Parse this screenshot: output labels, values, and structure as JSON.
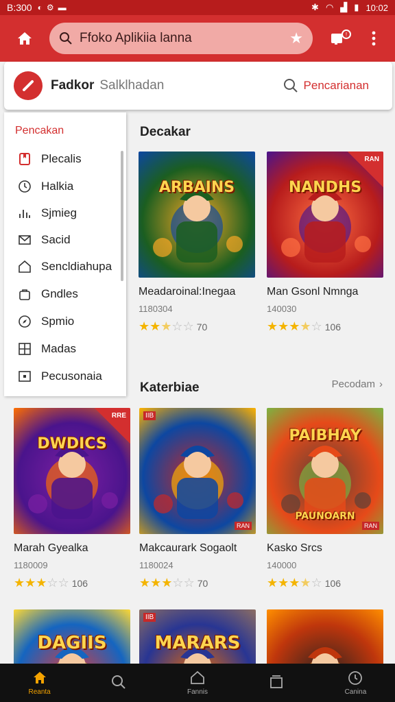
{
  "status": {
    "time_left": "B:300",
    "time_right": "10:02"
  },
  "appbar": {
    "search_text": "Ffoko Aplikiia lanna"
  },
  "header": {
    "title": "Fadkor",
    "subtitle": "Salklhadan",
    "search_label": "Pencarianan"
  },
  "drawer": {
    "heading": "Pencakan",
    "items": [
      {
        "label": "Plecalis",
        "icon": "bookmark-icon"
      },
      {
        "label": "Halkia",
        "icon": "clock-icon"
      },
      {
        "label": "Sjmieg",
        "icon": "chart-icon"
      },
      {
        "label": "Sacid",
        "icon": "mail-icon"
      },
      {
        "label": "Sencldiahupa",
        "icon": "house-icon"
      },
      {
        "label": "Gndles",
        "icon": "bag-icon"
      },
      {
        "label": "Spmio",
        "icon": "compass-icon"
      },
      {
        "label": "Madas",
        "icon": "grid-icon"
      },
      {
        "label": "Pecusonaia",
        "icon": "square-icon"
      }
    ]
  },
  "sections": {
    "featured_title": "Decakar",
    "category_title": "Katerbiae",
    "see_all": "Pecodam"
  },
  "games": [
    {
      "name": "Meadaroinal:Inegaa",
      "meta": "1180304",
      "rating": 2.5,
      "rating_value": "70",
      "art_text": "ARBAINS",
      "colors": [
        "#1b5e20",
        "#f9a825",
        "#0d47a1"
      ]
    },
    {
      "name": "Man Gsonl Nmnga",
      "meta": "140030",
      "rating": 3.5,
      "rating_value": "106",
      "art_text": "NANDHS",
      "colors": [
        "#b71c1c",
        "#ff7043",
        "#4a148c"
      ]
    },
    {
      "name": "Marah Gyealka",
      "meta": "1180009",
      "rating": 3,
      "rating_value": "106",
      "art_text": "DWDICS",
      "colors": [
        "#4a148c",
        "#7b1fa2",
        "#ff6f00"
      ]
    },
    {
      "name": "Makcaurark Sogaolt",
      "meta": "1180024",
      "rating": 3,
      "rating_value": "70",
      "art_text": "",
      "colors": [
        "#0d47a1",
        "#c62828",
        "#ffb300"
      ]
    },
    {
      "name": "Kasko Srcs",
      "meta": "140000",
      "rating": 3.5,
      "rating_value": "106",
      "art_text": "PAIBHAY",
      "colors": [
        "#e64a19",
        "#5d4037",
        "#7cb342"
      ]
    },
    {
      "name": "",
      "meta": "",
      "rating": 0,
      "rating_value": "",
      "art_text": "DAGIIS",
      "colors": [
        "#1565c0",
        "#e53935",
        "#fdd835"
      ]
    },
    {
      "name": "",
      "meta": "",
      "rating": 0,
      "rating_value": "",
      "art_text": "MARARS",
      "colors": [
        "#283593",
        "#ef6c00",
        "#8d6e63"
      ]
    },
    {
      "name": "",
      "meta": "",
      "rating": 0,
      "rating_value": "",
      "art_text": "",
      "colors": [
        "#bf360c",
        "#212121",
        "#ff8f00"
      ]
    }
  ],
  "art_tags": {
    "card2": "RAN",
    "card3": "RRE",
    "card4": "IIB",
    "card4_bottom": "RAN",
    "card5_bottom": "RAN",
    "card5_sub": "PAUNOARN",
    "card7": "IIB"
  },
  "bottom_nav": [
    {
      "label": "Reanta",
      "icon": "home-icon",
      "active": true
    },
    {
      "label": "",
      "icon": "search-icon",
      "active": false
    },
    {
      "label": "Fannis",
      "icon": "home-outline-icon",
      "active": false
    },
    {
      "label": "",
      "icon": "tabs-icon",
      "active": false
    },
    {
      "label": "Canina",
      "icon": "clock-icon",
      "active": false
    }
  ],
  "colors": {
    "primary": "#d32f2f",
    "primary_dark": "#b71c1c",
    "star": "#f4b400"
  }
}
